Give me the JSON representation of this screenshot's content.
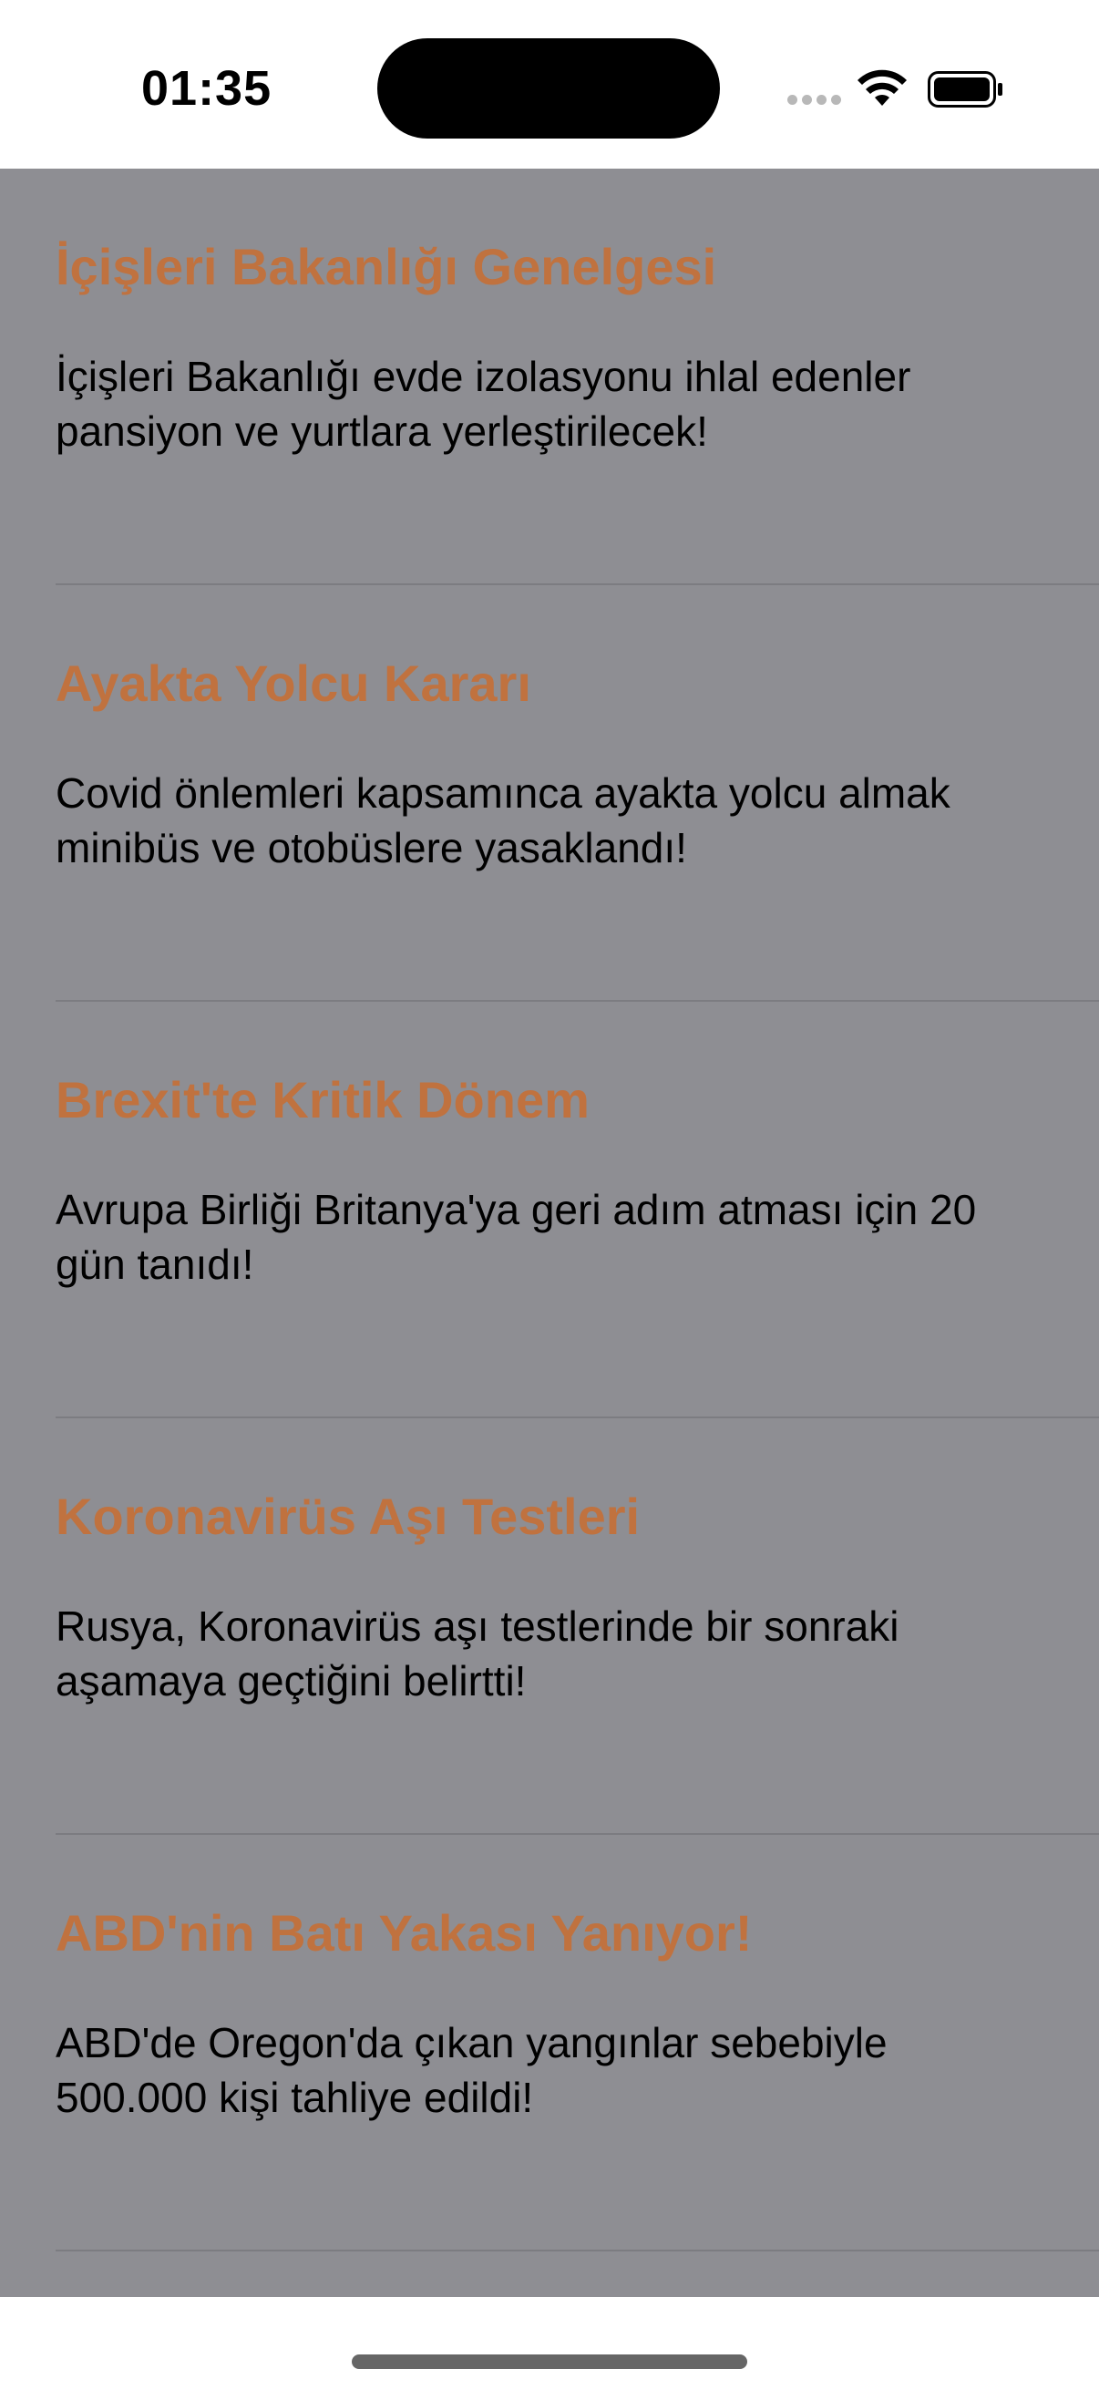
{
  "status_bar": {
    "time": "01:35",
    "icons": [
      "cellular-signal-icon",
      "wifi-icon",
      "battery-icon"
    ]
  },
  "news": [
    {
      "title": "İçişleri Bakanlığı Genelgesi",
      "description": "İçişleri Bakanlığı evde izolasyonu ihlal edenler pansiyon ve yurtlara yerleştirilecek!"
    },
    {
      "title": "Ayakta Yolcu Kararı",
      "description": "Covid önlemleri kapsamınca ayakta yolcu almak minibüs ve otobüslere yasaklandı!"
    },
    {
      "title": "Brexit'te Kritik Dönem",
      "description": "Avrupa Birliği Britanya'ya geri adım atması için 20 gün tanıdı!"
    },
    {
      "title": "Koronavirüs Aşı Testleri",
      "description": "Rusya, Koronavirüs aşı testlerinde bir sonraki aşamaya geçtiğini belirtti!"
    },
    {
      "title": "ABD'nin Batı Yakası Yanıyor!",
      "description": "ABD'de Oregon'da çıkan yangınlar sebebiyle 500.000 kişi tahliye edildi!"
    }
  ],
  "colors": {
    "title": "#c0723f",
    "list_background": "#8e8e93",
    "separator": "#7c7c81"
  }
}
